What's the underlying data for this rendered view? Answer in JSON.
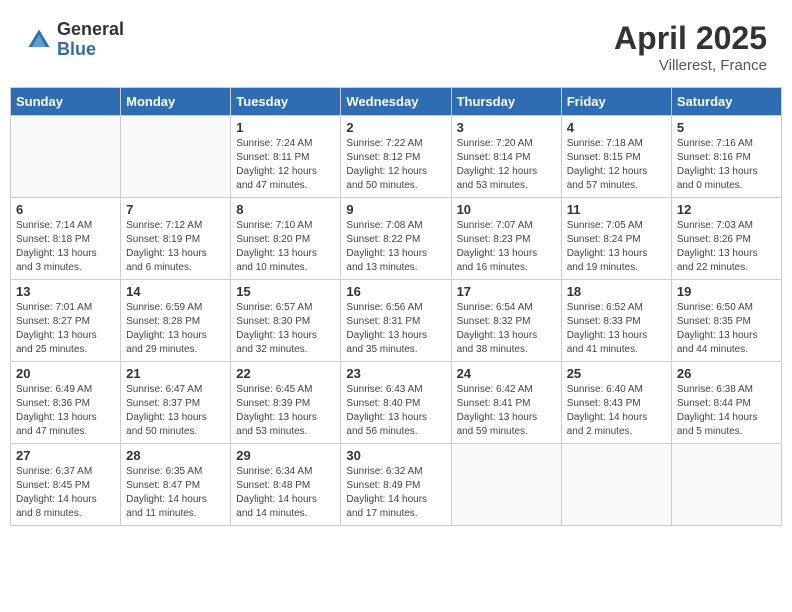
{
  "header": {
    "logo_general": "General",
    "logo_blue": "Blue",
    "month_title": "April 2025",
    "location": "Villerest, France"
  },
  "weekdays": [
    "Sunday",
    "Monday",
    "Tuesday",
    "Wednesday",
    "Thursday",
    "Friday",
    "Saturday"
  ],
  "weeks": [
    [
      {
        "day": "",
        "info": ""
      },
      {
        "day": "",
        "info": ""
      },
      {
        "day": "1",
        "info": "Sunrise: 7:24 AM\nSunset: 8:11 PM\nDaylight: 12 hours and 47 minutes."
      },
      {
        "day": "2",
        "info": "Sunrise: 7:22 AM\nSunset: 8:12 PM\nDaylight: 12 hours and 50 minutes."
      },
      {
        "day": "3",
        "info": "Sunrise: 7:20 AM\nSunset: 8:14 PM\nDaylight: 12 hours and 53 minutes."
      },
      {
        "day": "4",
        "info": "Sunrise: 7:18 AM\nSunset: 8:15 PM\nDaylight: 12 hours and 57 minutes."
      },
      {
        "day": "5",
        "info": "Sunrise: 7:16 AM\nSunset: 8:16 PM\nDaylight: 13 hours and 0 minutes."
      }
    ],
    [
      {
        "day": "6",
        "info": "Sunrise: 7:14 AM\nSunset: 8:18 PM\nDaylight: 13 hours and 3 minutes."
      },
      {
        "day": "7",
        "info": "Sunrise: 7:12 AM\nSunset: 8:19 PM\nDaylight: 13 hours and 6 minutes."
      },
      {
        "day": "8",
        "info": "Sunrise: 7:10 AM\nSunset: 8:20 PM\nDaylight: 13 hours and 10 minutes."
      },
      {
        "day": "9",
        "info": "Sunrise: 7:08 AM\nSunset: 8:22 PM\nDaylight: 13 hours and 13 minutes."
      },
      {
        "day": "10",
        "info": "Sunrise: 7:07 AM\nSunset: 8:23 PM\nDaylight: 13 hours and 16 minutes."
      },
      {
        "day": "11",
        "info": "Sunrise: 7:05 AM\nSunset: 8:24 PM\nDaylight: 13 hours and 19 minutes."
      },
      {
        "day": "12",
        "info": "Sunrise: 7:03 AM\nSunset: 8:26 PM\nDaylight: 13 hours and 22 minutes."
      }
    ],
    [
      {
        "day": "13",
        "info": "Sunrise: 7:01 AM\nSunset: 8:27 PM\nDaylight: 13 hours and 25 minutes."
      },
      {
        "day": "14",
        "info": "Sunrise: 6:59 AM\nSunset: 8:28 PM\nDaylight: 13 hours and 29 minutes."
      },
      {
        "day": "15",
        "info": "Sunrise: 6:57 AM\nSunset: 8:30 PM\nDaylight: 13 hours and 32 minutes."
      },
      {
        "day": "16",
        "info": "Sunrise: 6:56 AM\nSunset: 8:31 PM\nDaylight: 13 hours and 35 minutes."
      },
      {
        "day": "17",
        "info": "Sunrise: 6:54 AM\nSunset: 8:32 PM\nDaylight: 13 hours and 38 minutes."
      },
      {
        "day": "18",
        "info": "Sunrise: 6:52 AM\nSunset: 8:33 PM\nDaylight: 13 hours and 41 minutes."
      },
      {
        "day": "19",
        "info": "Sunrise: 6:50 AM\nSunset: 8:35 PM\nDaylight: 13 hours and 44 minutes."
      }
    ],
    [
      {
        "day": "20",
        "info": "Sunrise: 6:49 AM\nSunset: 8:36 PM\nDaylight: 13 hours and 47 minutes."
      },
      {
        "day": "21",
        "info": "Sunrise: 6:47 AM\nSunset: 8:37 PM\nDaylight: 13 hours and 50 minutes."
      },
      {
        "day": "22",
        "info": "Sunrise: 6:45 AM\nSunset: 8:39 PM\nDaylight: 13 hours and 53 minutes."
      },
      {
        "day": "23",
        "info": "Sunrise: 6:43 AM\nSunset: 8:40 PM\nDaylight: 13 hours and 56 minutes."
      },
      {
        "day": "24",
        "info": "Sunrise: 6:42 AM\nSunset: 8:41 PM\nDaylight: 13 hours and 59 minutes."
      },
      {
        "day": "25",
        "info": "Sunrise: 6:40 AM\nSunset: 8:43 PM\nDaylight: 14 hours and 2 minutes."
      },
      {
        "day": "26",
        "info": "Sunrise: 6:38 AM\nSunset: 8:44 PM\nDaylight: 14 hours and 5 minutes."
      }
    ],
    [
      {
        "day": "27",
        "info": "Sunrise: 6:37 AM\nSunset: 8:45 PM\nDaylight: 14 hours and 8 minutes."
      },
      {
        "day": "28",
        "info": "Sunrise: 6:35 AM\nSunset: 8:47 PM\nDaylight: 14 hours and 11 minutes."
      },
      {
        "day": "29",
        "info": "Sunrise: 6:34 AM\nSunset: 8:48 PM\nDaylight: 14 hours and 14 minutes."
      },
      {
        "day": "30",
        "info": "Sunrise: 6:32 AM\nSunset: 8:49 PM\nDaylight: 14 hours and 17 minutes."
      },
      {
        "day": "",
        "info": ""
      },
      {
        "day": "",
        "info": ""
      },
      {
        "day": "",
        "info": ""
      }
    ]
  ]
}
